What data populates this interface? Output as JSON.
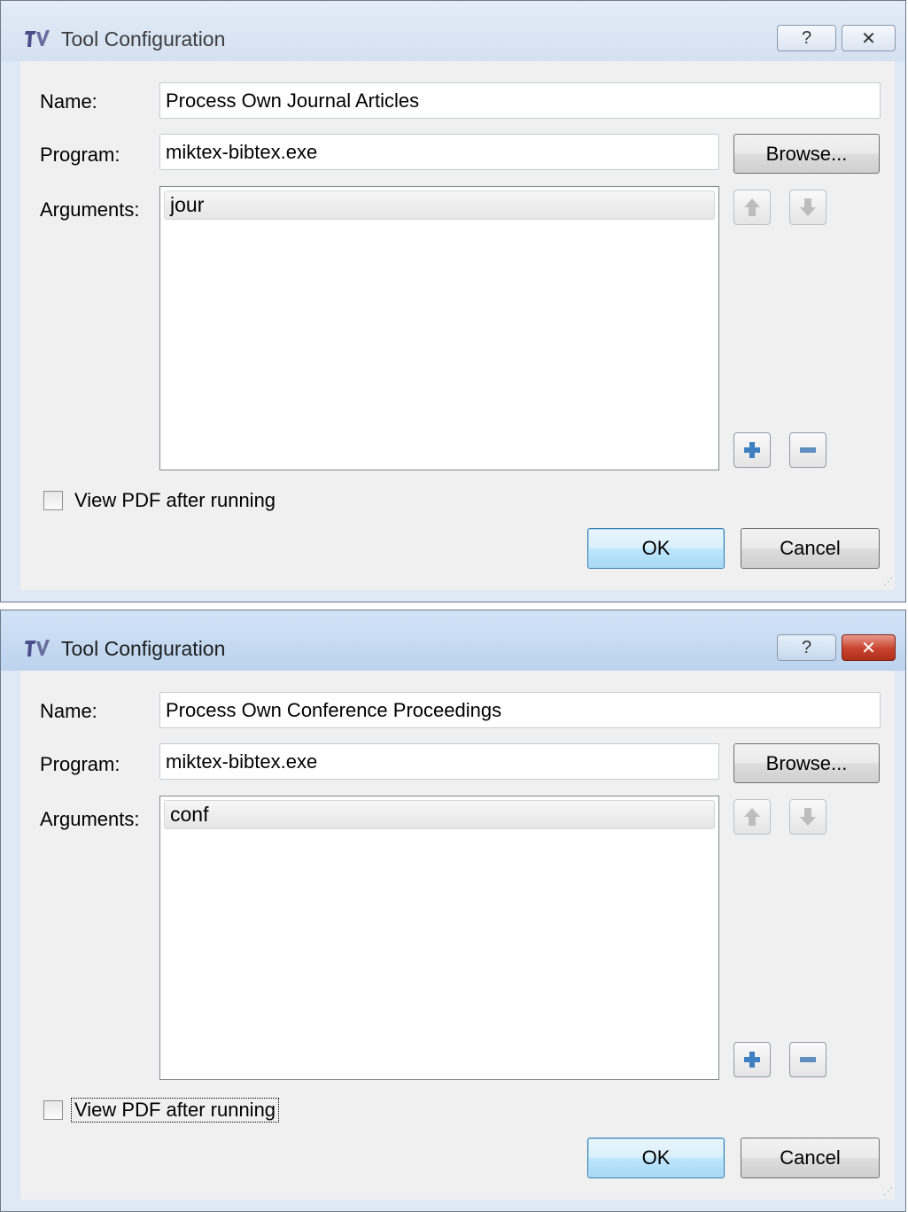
{
  "dialogs": [
    {
      "title": "Tool Configuration",
      "help_glyph": "?",
      "close_glyph": "✕",
      "name_label": "Name:",
      "name_value": "Process Own Journal Articles",
      "program_label": "Program:",
      "program_value": "miktex-bibtex.exe",
      "browse_label": "Browse...",
      "arguments_label": "Arguments:",
      "arguments": [
        "jour"
      ],
      "checkbox_label": "View PDF after running",
      "checkbox_checked": false,
      "ok_label": "OK",
      "cancel_label": "Cancel",
      "active": false
    },
    {
      "title": "Tool Configuration",
      "help_glyph": "?",
      "close_glyph": "✕",
      "name_label": "Name:",
      "name_value": "Process Own Conference Proceedings",
      "program_label": "Program:",
      "program_value": "miktex-bibtex.exe",
      "browse_label": "Browse...",
      "arguments_label": "Arguments:",
      "arguments": [
        "conf"
      ],
      "checkbox_label": "View PDF after running",
      "checkbox_checked": false,
      "ok_label": "OK",
      "cancel_label": "Cancel",
      "active": true
    }
  ],
  "icons": {
    "app": "texworks-app-icon",
    "move_up": "arrow-up-icon",
    "move_down": "arrow-down-icon",
    "add": "plus-icon",
    "remove": "minus-icon",
    "resize": "resize-grip-icon"
  },
  "colors": {
    "close_active": "#c7432e",
    "ok_border": "#3c7fb1",
    "plus_icon": "#3f7fc2",
    "minus_icon": "#5f8fc0"
  }
}
